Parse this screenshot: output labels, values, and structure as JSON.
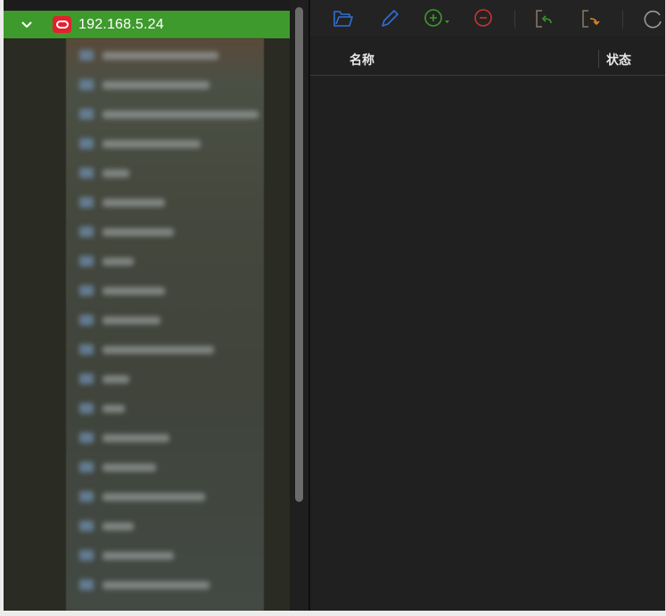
{
  "tree": {
    "connection": {
      "label": "192.168.5.24",
      "icon": "oracle-db-icon",
      "expanded": true,
      "accent": "#3e9a2c",
      "badge_color": "#e4202f"
    }
  },
  "toolbar": {
    "buttons": [
      {
        "icon": "open-folder-icon",
        "color": "#2f6fd6"
      },
      {
        "icon": "edit-pencil-icon",
        "color": "#2f6fd6"
      },
      {
        "icon": "add-circle-dropdown-icon",
        "color": "#3a9a2a"
      },
      {
        "icon": "remove-circle-icon",
        "color": "#c83434"
      },
      {
        "icon": "import-icon",
        "color": "#d88a2a"
      },
      {
        "icon": "export-icon",
        "color": "#d88a2a"
      },
      {
        "icon": "refresh-icon",
        "color": "#9a9a9a"
      }
    ]
  },
  "list": {
    "columns": {
      "name": "名称",
      "status": "状态"
    }
  }
}
